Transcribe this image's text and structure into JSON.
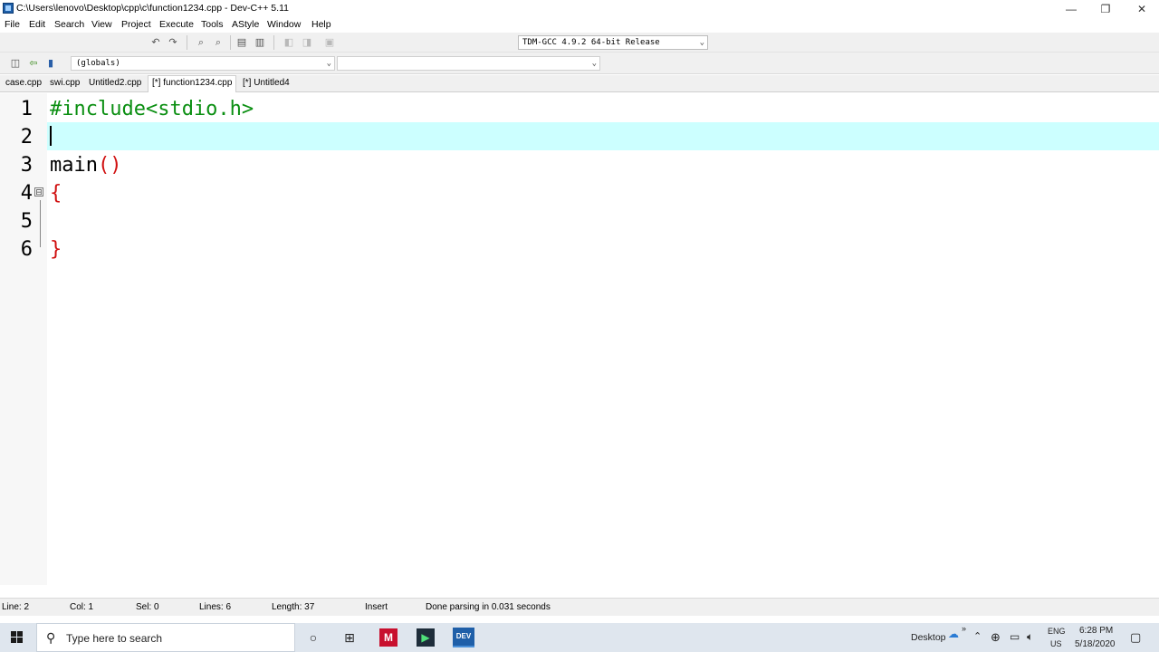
{
  "window": {
    "title": "C:\\Users\\lenovo\\Desktop\\cpp\\c\\function1234.cpp - Dev-C++ 5.11",
    "min_glyph": "—",
    "max_glyph": "❐",
    "close_glyph": "✕"
  },
  "menu": [
    "File",
    "Edit",
    "Search",
    "View",
    "Project",
    "Execute",
    "Tools",
    "AStyle",
    "Window",
    "Help"
  ],
  "toolbar": {
    "compiler": "TDM-GCC 4.9.2 64-bit Release",
    "scope_combo": "(globals)",
    "symbol_combo": ""
  },
  "tabs": [
    "case.cpp",
    "swi.cpp",
    "Untitled2.cpp",
    "[*] function1234.cpp",
    "[*] Untitled4"
  ],
  "active_tab_index": 3,
  "editor": {
    "line_numbers": [
      "1",
      "2",
      "3",
      "4",
      "5",
      "6"
    ],
    "lines": [
      [
        {
          "text": "#include<stdio.h>",
          "color": "#0b8f12"
        }
      ],
      [],
      [
        {
          "text": "main",
          "color": "#000000"
        },
        {
          "text": "()",
          "color": "#d01010"
        }
      ],
      [
        {
          "text": "{",
          "color": "#d01010"
        }
      ],
      [],
      [
        {
          "text": "}",
          "color": "#d01010"
        }
      ]
    ],
    "current_line": 2,
    "fold_glyph": "⊟"
  },
  "status": {
    "line": "Line:   2",
    "col": "Col:   1",
    "sel": "Sel:   0",
    "lines": "Lines:   6",
    "length": "Length:   37",
    "mode": "Insert",
    "message": "Done parsing in 0.031 seconds"
  },
  "taskbar": {
    "search_placeholder": "Type here to search",
    "desktop_label": "Desktop",
    "lang_top": "ENG",
    "lang_bottom": "US",
    "time": "6:28 PM",
    "date": "5/18/2020",
    "icons": [
      "cortana-icon",
      "task-view-icon",
      "mcafee-icon",
      "pycharm-icon",
      "devcpp-icon"
    ]
  },
  "colors": {
    "highlight_line": "#ccffff",
    "include_green": "#0b8f12",
    "brace_red": "#d01010"
  }
}
